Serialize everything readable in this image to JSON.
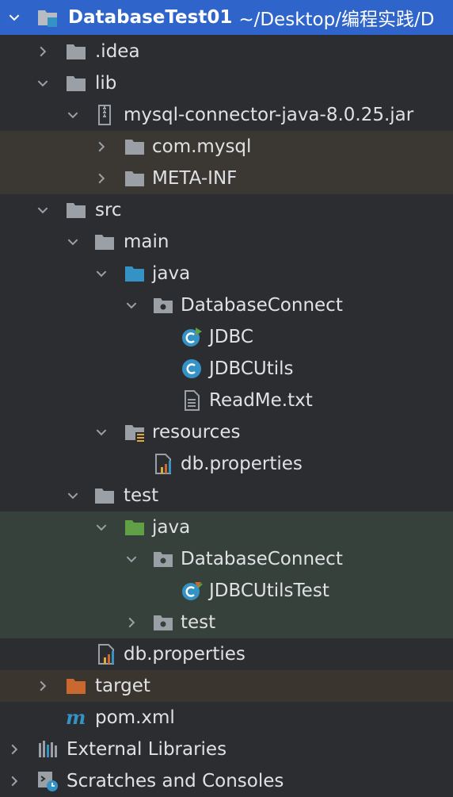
{
  "project": {
    "name": "DatabaseTest01",
    "path": "~/Desktop/编程实践/D"
  },
  "tree": {
    "idea": ".idea",
    "lib": "lib",
    "jar": "mysql-connector-java-8.0.25.jar",
    "com_mysql": "com.mysql",
    "meta_inf": "META-INF",
    "src": "src",
    "main": "main",
    "main_java": "java",
    "main_pkg": "DatabaseConnect",
    "jdbc": "JDBC",
    "jdbcutils": "JDBCUtils",
    "readme": "ReadMe.txt",
    "resources": "resources",
    "res_props": "db.properties",
    "test": "test",
    "test_java": "java",
    "test_pkg": "DatabaseConnect",
    "jdbcutilstest": "JDBCUtilsTest",
    "test_sub": "test",
    "src_props": "db.properties",
    "target": "target",
    "pom": "pom.xml",
    "ext_libs": "External Libraries",
    "scratches": "Scratches and Consoles"
  },
  "colors": {
    "selection": "#2f65ca",
    "folder": "#9aa0a6",
    "source_root": "#3592c4",
    "test_root": "#5fa144",
    "excluded": "#c9692f"
  }
}
